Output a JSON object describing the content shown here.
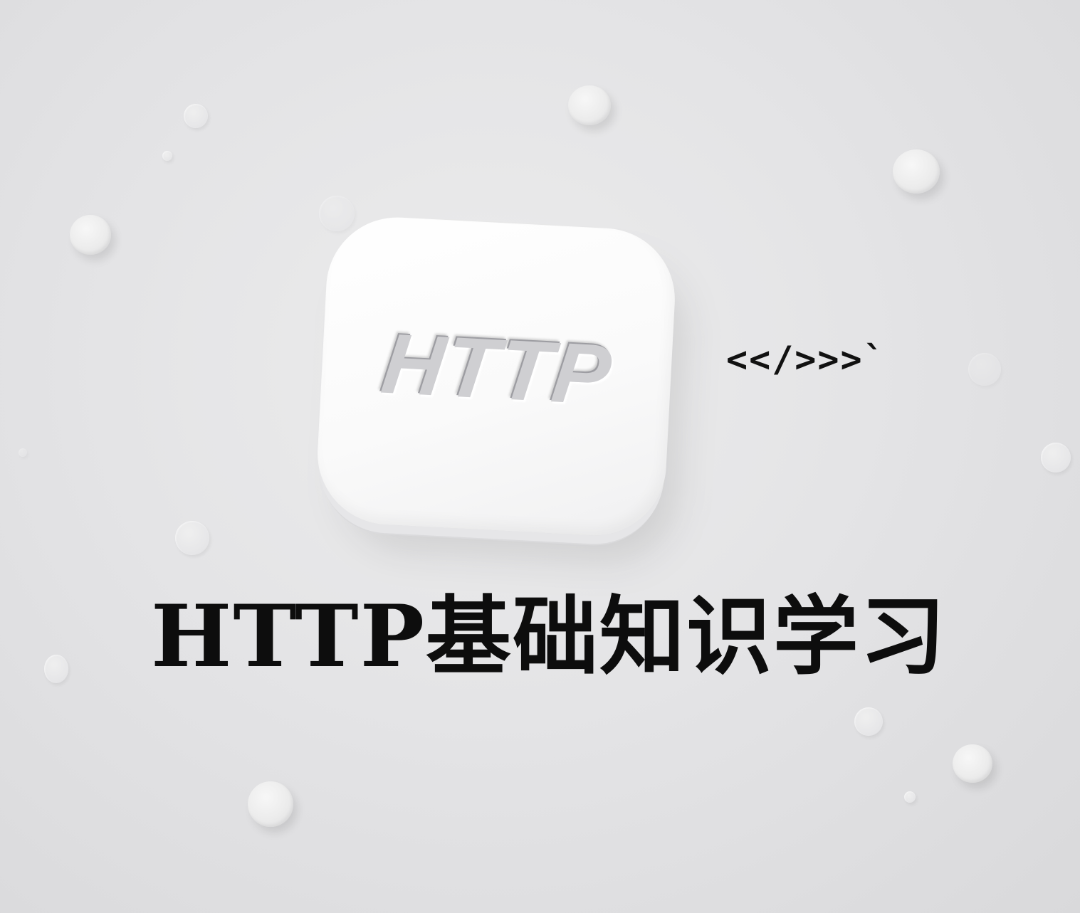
{
  "tile": {
    "label": "HTTP",
    "icon": "http-tile-icon"
  },
  "code_glyph": {
    "text": "<</>>>`"
  },
  "headline": {
    "text": "HTTP基础知识学习"
  },
  "colors": {
    "background": "#e4e4e6",
    "tile": "#ffffff",
    "headline": "#0d0d0d"
  }
}
